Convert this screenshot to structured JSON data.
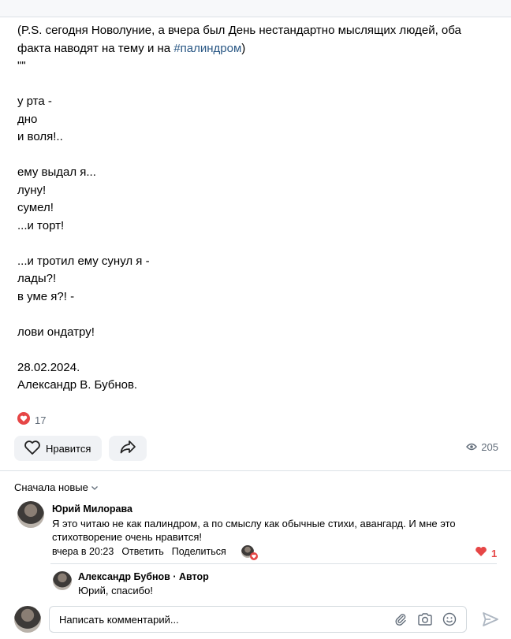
{
  "post": {
    "lines": [
      "(P.S. сегодня Новолуние, а вчера был День нестандартно мыслящих людей, оба",
      "факта наводят на тему и на ",
      "\"\"",
      "",
      "у рта -",
      "дно",
      "и воля!..",
      "",
      "ему выдал я...",
      "луну!",
      "сумел!",
      "...и торт!",
      "",
      "...и тротил ему сунул я -",
      "лады?!",
      "в уме я?! -",
      "",
      "лови ондатру!",
      "",
      "28.02.2024.",
      "Александр В. Бубнов."
    ],
    "hashtag": "#палиндром",
    "hashtag_after": ")",
    "reaction_count": "17",
    "like_label": "Нравится",
    "views": "205"
  },
  "comments_section": {
    "sort_label": "Сначала новые",
    "comment": {
      "author": "Юрий Милорава",
      "text": "Я это читаю не как палиндром, а по смыслу как обычные стихи, авангард. И мне это стихотворение очень нравится!",
      "time": "вчера в 20:23",
      "reply_label": "Ответить",
      "share_label": "Поделиться",
      "likes": "1"
    },
    "reply": {
      "author": "Александр Бубнов · Автор",
      "text": "Юрий, спасибо!"
    }
  },
  "comment_box": {
    "placeholder": "Написать комментарий..."
  },
  "colors": {
    "heart": "#e64646",
    "hashtag": "#2a5885",
    "button_bg": "#f0f2f5"
  }
}
